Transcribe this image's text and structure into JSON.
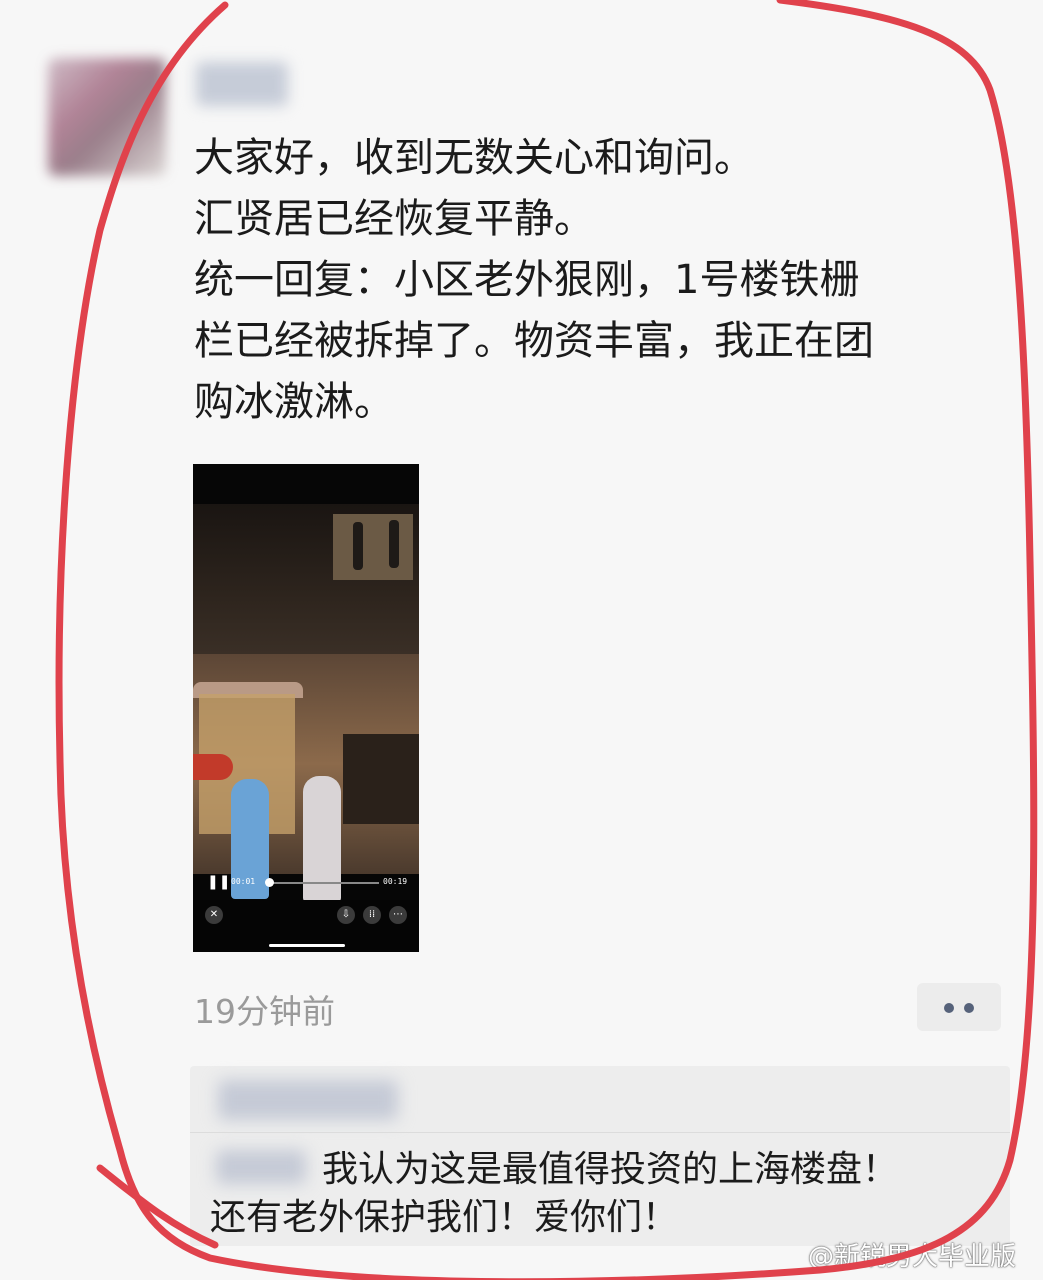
{
  "post": {
    "text": "大家好，收到无数关心和询问。\n汇贤居已经恢复平静。\n统一回复：小区老外狠刚，1号楼铁栅\n栏已经被拆掉了。物资丰富，我正在团\n购冰激淋。",
    "time_ago": "19分钟前"
  },
  "video": {
    "current_time": "00:01",
    "duration": "00:19",
    "progress": 0.05,
    "icons": [
      "pause-icon",
      "close-icon",
      "download-icon",
      "grid-icon",
      "more-icon"
    ]
  },
  "comment": {
    "text": "我认为这是最值得投资的上海楼盘！\n还有老外保护我们！爱你们！"
  },
  "watermark": {
    "text": "@新锐男大毕业版"
  },
  "colors": {
    "annotation_stroke": "#e0424c",
    "background": "#f7f7f7",
    "comment_bg": "#ededed",
    "timestamp": "#9a9a9a",
    "dots": "#56627a"
  }
}
